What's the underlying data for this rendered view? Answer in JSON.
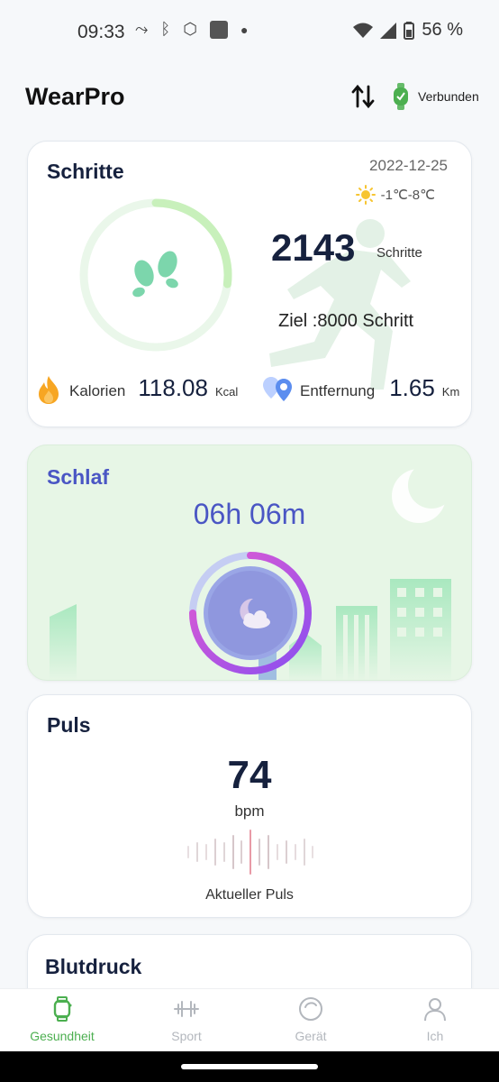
{
  "status_bar": {
    "time": "09:33",
    "battery": "56 %"
  },
  "header": {
    "title": "WearPro",
    "connection_status": "Verbunden"
  },
  "steps": {
    "title": "Schritte",
    "date": "2022-12-25",
    "weather": "-1℃-8℃",
    "count": "2143",
    "unit": "Schritte",
    "goal": "Ziel :8000 Schritt",
    "progress_fraction": 0.27,
    "calories_label": "Kalorien",
    "calories_value": "118.08",
    "calories_unit": "Kcal",
    "distance_label": "Entfernung",
    "distance_value": "1.65",
    "distance_unit": "Km"
  },
  "sleep": {
    "title": "Schlaf",
    "duration": "06h 06m"
  },
  "pulse": {
    "title": "Puls",
    "value": "74",
    "unit": "bpm",
    "label": "Aktueller Puls"
  },
  "blood_pressure": {
    "title": "Blutdruck"
  },
  "nav": {
    "items": [
      {
        "label": "Gesundheit",
        "icon": "watch-icon",
        "active": true
      },
      {
        "label": "Sport",
        "icon": "dumbbell-icon",
        "active": false
      },
      {
        "label": "Gerät",
        "icon": "device-icon",
        "active": false
      },
      {
        "label": "Ich",
        "icon": "person-icon",
        "active": false
      }
    ]
  },
  "colors": {
    "accent_green": "#4caf50",
    "sleep_text": "#4a56c4",
    "sleep_bg": "#e7f6e6"
  }
}
